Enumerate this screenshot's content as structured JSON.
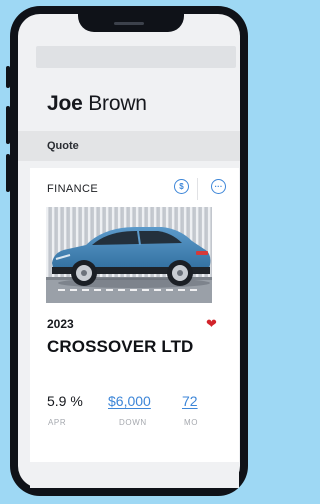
{
  "customer": {
    "first_name": "Joe",
    "last_name": "Brown"
  },
  "section": {
    "title": "Quote"
  },
  "card": {
    "label": "FINANCE",
    "header_icons": [
      "dollar-circle-icon",
      "chat-bubble-icon"
    ],
    "year": "2023",
    "model": "CROSSOVER LTD",
    "favorite_icon": "heart-icon",
    "favorite_color": "#d2232a",
    "stats": [
      {
        "value": "5.9 %",
        "caption": "APR"
      },
      {
        "value": "$6,000",
        "caption": "DOWN"
      },
      {
        "value": "72",
        "caption": "MO"
      }
    ]
  },
  "colors": {
    "background": "#9ed8f4",
    "accent": "#3d86d8",
    "phone_frame": "#0f1218",
    "car_body": "#3f7fb0"
  }
}
